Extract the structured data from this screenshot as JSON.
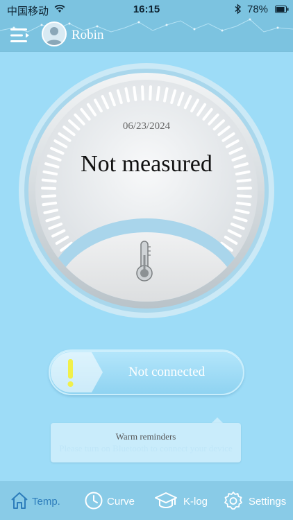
{
  "status_bar": {
    "carrier": "中国移动",
    "time": "16:15",
    "battery": "78%"
  },
  "header": {
    "username": "Robin"
  },
  "gauge": {
    "date": "06/23/2024",
    "status": "Not measured"
  },
  "connection": {
    "status": "Not connected"
  },
  "reminder": {
    "title": "Warm reminders",
    "message": "Please turn on Bluetooth to connect your device"
  },
  "tabs": [
    {
      "label": "Temp.",
      "icon": "home-icon",
      "active": true
    },
    {
      "label": "Curve",
      "icon": "clock-icon",
      "active": false
    },
    {
      "label": "K-log",
      "icon": "graduation-cap-icon",
      "active": false
    },
    {
      "label": "Settings",
      "icon": "gear-icon",
      "active": false
    }
  ],
  "colors": {
    "background": "#9ddcf7",
    "header": "#7cc3e0",
    "tabbar": "#89cbe7",
    "active_tab": "#2d7dbb",
    "warning": "#f1f04a"
  }
}
